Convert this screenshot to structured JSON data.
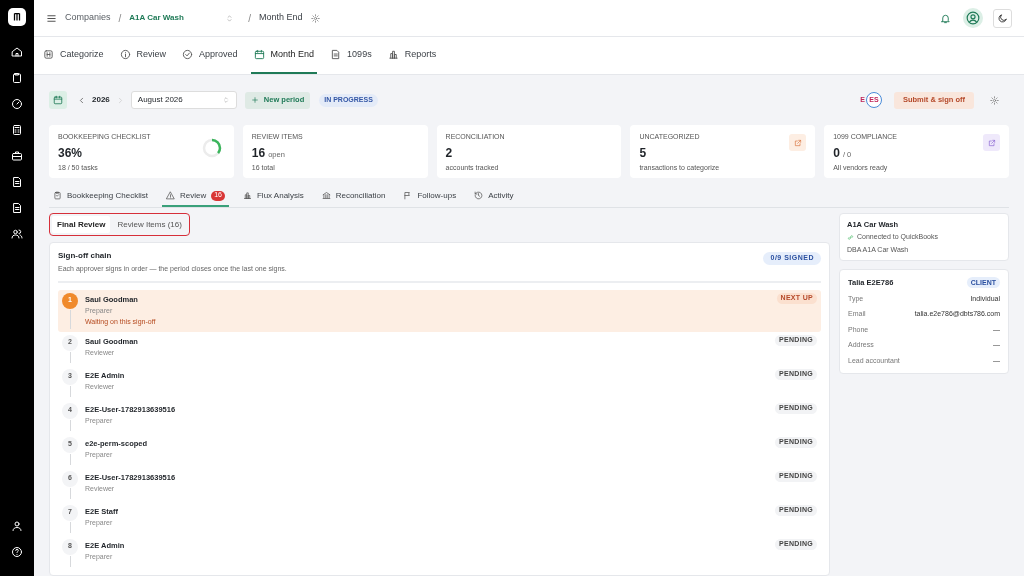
{
  "breadcrumb": {
    "root": "Companies",
    "separators": [
      "/",
      "/"
    ],
    "company": "A1A Car Wash",
    "page": "Month End"
  },
  "nav_tabs": [
    {
      "label": "Categorize",
      "selected": false
    },
    {
      "label": "Review",
      "selected": false
    },
    {
      "label": "Approved",
      "selected": false
    },
    {
      "label": "Month End",
      "selected": true
    },
    {
      "label": "1099s",
      "selected": false
    },
    {
      "label": "Reports",
      "selected": false
    }
  ],
  "period": {
    "year": "2026",
    "month": "August 2026",
    "new_period": "New period",
    "status": "IN PROGRESS",
    "avatars": [
      "E",
      "ES"
    ],
    "submit": "Submit & sign off"
  },
  "stats": [
    {
      "label": "BOOKKEEPING CHECKLIST",
      "value": "36%",
      "sub": "18 / 50 tasks",
      "kind": "ring",
      "level": 0.36
    },
    {
      "label": "REVIEW ITEMS",
      "value": "16",
      "unit": "open",
      "sub": "16 total",
      "kind": "plain"
    },
    {
      "label": "RECONCILIATION",
      "value": "2",
      "sub": "accounts tracked",
      "kind": "plain"
    },
    {
      "label": "UNCATEGORIZED",
      "value": "5",
      "sub": "transactions to categorize",
      "kind": "link",
      "color": "#fdeee3"
    },
    {
      "label": "1099 COMPLIANCE",
      "value": "0",
      "unit": "/ 0",
      "sub": "All vendors ready",
      "kind": "link",
      "color": "#efe9fb"
    }
  ],
  "sub_tabs": [
    {
      "label": "Bookkeeping Checklist",
      "selected": false
    },
    {
      "label": "Review",
      "badge": "16",
      "selected": true
    },
    {
      "label": "Flux Analysis",
      "selected": false
    },
    {
      "label": "Reconciliation",
      "selected": false
    },
    {
      "label": "Follow-ups",
      "selected": false
    },
    {
      "label": "Activity",
      "selected": false
    }
  ],
  "segments": [
    {
      "label": "Final Review",
      "selected": true
    },
    {
      "label": "Review Items (16)",
      "selected": false
    }
  ],
  "signoff": {
    "title": "Sign-off chain",
    "subtitle": "Each approver signs in order — the period closes once the last one signs.",
    "progress": "0/9 SIGNED",
    "steps": [
      {
        "number": "1",
        "name": "Saul Goodman",
        "role": "Preparer",
        "note": "Waiting on this sign-off",
        "status": "NEXT UP",
        "selected": true
      },
      {
        "number": "2",
        "name": "Saul Goodman",
        "role": "Reviewer",
        "status": "PENDING",
        "selected": false
      },
      {
        "number": "3",
        "name": "E2E Admin",
        "role": "Reviewer",
        "status": "PENDING",
        "selected": false
      },
      {
        "number": "4",
        "name": "E2E-User-1782913639516",
        "role": "Preparer",
        "status": "PENDING",
        "selected": false
      },
      {
        "number": "5",
        "name": "e2e-perm-scoped",
        "role": "Preparer",
        "status": "PENDING",
        "selected": false
      },
      {
        "number": "6",
        "name": "E2E-User-1782913639516",
        "role": "Reviewer",
        "status": "PENDING",
        "selected": false
      },
      {
        "number": "7",
        "name": "E2E Staff",
        "role": "Preparer",
        "status": "PENDING",
        "selected": false
      },
      {
        "number": "8",
        "name": "E2E Admin",
        "role": "Preparer",
        "status": "PENDING",
        "selected": false
      }
    ]
  },
  "company_card": {
    "name": "A1A Car Wash",
    "connection": "Connected to QuickBooks",
    "dba": "DBA A1A Car Wash"
  },
  "client_card": {
    "name": "Talia E2E786",
    "badge": "CLIENT",
    "fields": [
      {
        "label": "Type",
        "value": "Individual"
      },
      {
        "label": "Email",
        "value": "talia.e2e786@dbts786.com"
      },
      {
        "label": "Phone",
        "value": "—"
      },
      {
        "label": "Address",
        "value": "—"
      },
      {
        "label": "Lead accountant",
        "value": "—"
      }
    ]
  }
}
